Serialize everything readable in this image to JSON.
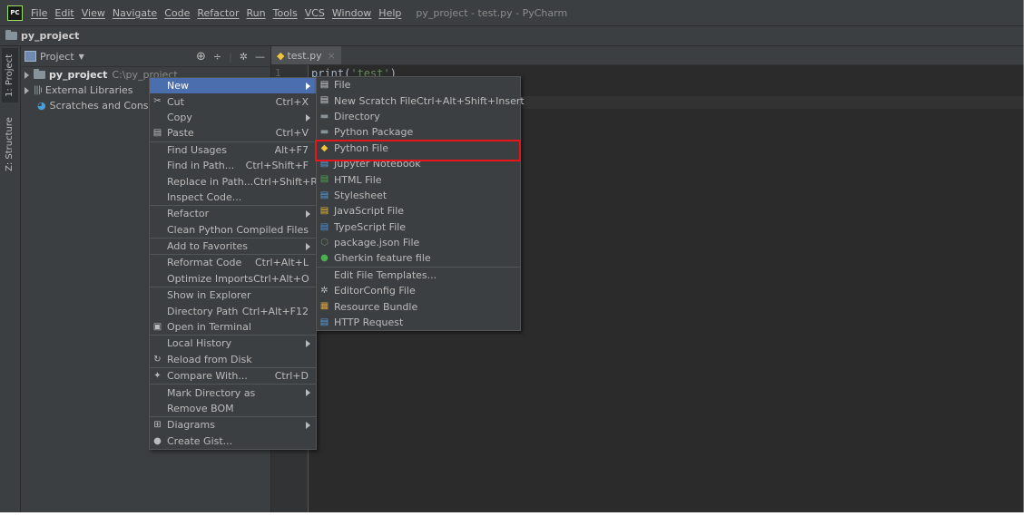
{
  "window": {
    "title": "py_project - test.py - PyCharm",
    "app_badge": "PC"
  },
  "menubar": [
    "File",
    "Edit",
    "View",
    "Navigate",
    "Code",
    "Refactor",
    "Run",
    "Tools",
    "VCS",
    "Window",
    "Help"
  ],
  "breadcrumb": {
    "project": "py_project"
  },
  "side_tabs": {
    "project": "1: Project",
    "structure": "Z: Structure"
  },
  "project_panel": {
    "dropdown_label": "Project",
    "tree": [
      {
        "name": "py_project",
        "path": "C:\\py_project"
      },
      {
        "name": "External Libraries"
      },
      {
        "name": "Scratches and Consoles"
      }
    ]
  },
  "editor": {
    "tab": "test.py",
    "line_number": "1",
    "code": {
      "fn": "print(",
      "str": "'test'",
      "close": ")"
    }
  },
  "context_menu": [
    {
      "label": "New",
      "selected": true,
      "submenu": true
    },
    {
      "label": "Cut",
      "shortcut": "Ctrl+X",
      "icon": "scissors-icon"
    },
    {
      "label": "Copy",
      "submenu": true
    },
    {
      "label": "Paste",
      "shortcut": "Ctrl+V",
      "icon": "clipboard-icon"
    },
    {
      "sep": true
    },
    {
      "label": "Find Usages",
      "shortcut": "Alt+F7"
    },
    {
      "label": "Find in Path...",
      "shortcut": "Ctrl+Shift+F"
    },
    {
      "label": "Replace in Path...",
      "shortcut": "Ctrl+Shift+R"
    },
    {
      "label": "Inspect Code..."
    },
    {
      "sep": true
    },
    {
      "label": "Refactor",
      "submenu": true
    },
    {
      "label": "Clean Python Compiled Files"
    },
    {
      "sep": true
    },
    {
      "label": "Add to Favorites",
      "submenu": true
    },
    {
      "sep": true
    },
    {
      "label": "Reformat Code",
      "shortcut": "Ctrl+Alt+L"
    },
    {
      "label": "Optimize Imports",
      "shortcut": "Ctrl+Alt+O"
    },
    {
      "sep": true
    },
    {
      "label": "Show in Explorer"
    },
    {
      "label": "Directory Path",
      "shortcut": "Ctrl+Alt+F12"
    },
    {
      "label": "Open in Terminal",
      "icon": "terminal-icon"
    },
    {
      "sep": true
    },
    {
      "label": "Local History",
      "submenu": true
    },
    {
      "label": "Reload from Disk",
      "icon": "reload-icon"
    },
    {
      "sep": true
    },
    {
      "label": "Compare With...",
      "shortcut": "Ctrl+D",
      "icon": "compare-icon"
    },
    {
      "sep": true
    },
    {
      "label": "Mark Directory as",
      "submenu": true
    },
    {
      "label": "Remove BOM"
    },
    {
      "sep": true
    },
    {
      "label": "Diagrams",
      "submenu": true,
      "icon": "diagram-icon"
    },
    {
      "label": "Create Gist...",
      "icon": "github-icon"
    }
  ],
  "submenu": [
    {
      "label": "File",
      "icon": "file-icon",
      "color": "#d0d0d0"
    },
    {
      "label": "New Scratch File",
      "shortcut": "Ctrl+Alt+Shift+Insert",
      "icon": "scratch-file-icon",
      "color": "#d0d0d0"
    },
    {
      "label": "Directory",
      "icon": "folder-icon",
      "color": "#87939a"
    },
    {
      "label": "Python Package",
      "icon": "package-icon",
      "color": "#87939a"
    },
    {
      "label": "Python File",
      "icon": "python-icon",
      "color": "#f0c43a",
      "highlighted": true
    },
    {
      "label": "Jupyter Notebook",
      "icon": "jupyter-icon",
      "color": "#5a9bd5"
    },
    {
      "label": "HTML File",
      "icon": "html-file-icon",
      "color": "#4ea24f"
    },
    {
      "label": "Stylesheet",
      "icon": "css-file-icon",
      "color": "#5a9bd5"
    },
    {
      "label": "JavaScript File",
      "icon": "js-file-icon",
      "color": "#e0b93a"
    },
    {
      "label": "TypeScript File",
      "icon": "ts-file-icon",
      "color": "#4a8fd5"
    },
    {
      "label": "package.json File",
      "icon": "npm-icon",
      "color": "#6a8a6a"
    },
    {
      "label": "Gherkin feature file",
      "icon": "gherkin-icon",
      "color": "#4caf50"
    },
    {
      "sep": true
    },
    {
      "label": "Edit File Templates..."
    },
    {
      "label": "EditorConfig File",
      "icon": "gear-icon",
      "color": "#bbbbbb"
    },
    {
      "label": "Resource Bundle",
      "icon": "bundle-icon",
      "color": "#d9a23a"
    },
    {
      "label": "HTTP Request",
      "icon": "api-icon",
      "color": "#5a9bd5"
    }
  ],
  "colors": {
    "selection": "#4b6eaf",
    "highlight": "#e8161b",
    "string": "#6a8759",
    "code": "#a9b7c6"
  }
}
